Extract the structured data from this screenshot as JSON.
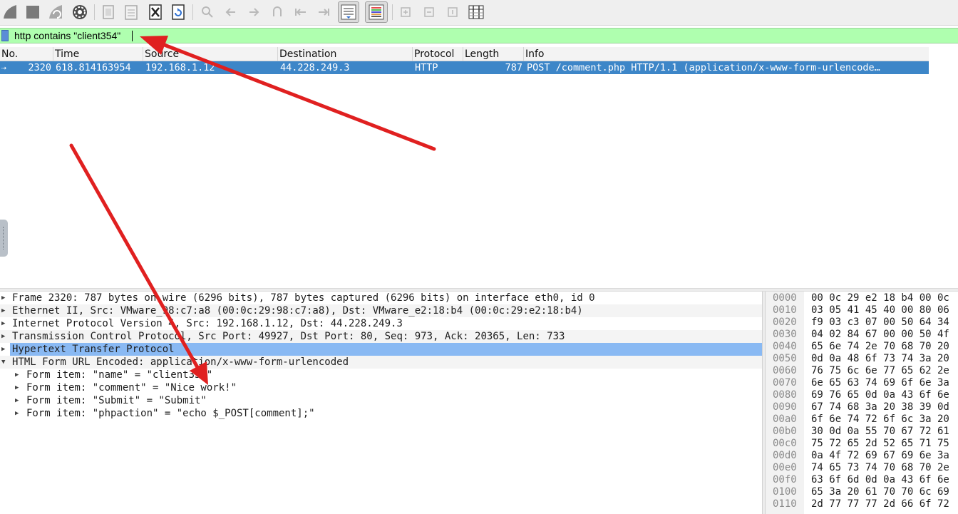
{
  "toolbar": {
    "buttons": [
      {
        "name": "start-capture-icon"
      },
      {
        "name": "stop-capture-icon"
      },
      {
        "name": "restart-capture-icon"
      },
      {
        "name": "capture-options-icon"
      },
      {
        "name": "open-file-icon"
      },
      {
        "name": "save-file-icon"
      },
      {
        "name": "close-file-icon"
      },
      {
        "name": "reload-file-icon"
      },
      {
        "name": "find-packet-icon"
      },
      {
        "name": "go-back-icon"
      },
      {
        "name": "go-forward-icon"
      },
      {
        "name": "go-to-packet-icon"
      },
      {
        "name": "go-first-icon"
      },
      {
        "name": "go-last-icon"
      },
      {
        "name": "auto-scroll-icon"
      },
      {
        "name": "colorize-icon"
      },
      {
        "name": "zoom-in-icon"
      },
      {
        "name": "zoom-out-icon"
      },
      {
        "name": "normal-size-icon"
      },
      {
        "name": "resize-columns-icon"
      }
    ]
  },
  "filter": {
    "value": "http contains \"client354\""
  },
  "packet_list": {
    "columns": [
      "No.",
      "Time",
      "Source",
      "Destination",
      "Protocol",
      "Length",
      "Info"
    ],
    "rows": [
      {
        "no": "2320",
        "time": "618.814163954",
        "source": "192.168.1.12",
        "destination": "44.228.249.3",
        "protocol": "HTTP",
        "length": "787",
        "info": "POST /comment.php HTTP/1.1  (application/x-www-form-urlencode…"
      }
    ]
  },
  "details": {
    "rows": [
      {
        "text": "Frame 2320: 787 bytes on wire (6296 bits), 787 bytes captured (6296 bits) on interface eth0, id 0",
        "expanded": false,
        "indent": 0
      },
      {
        "text": "Ethernet II, Src: VMware_98:c7:a8 (00:0c:29:98:c7:a8), Dst: VMware_e2:18:b4 (00:0c:29:e2:18:b4)",
        "expanded": false,
        "indent": 0
      },
      {
        "text": "Internet Protocol Version 4, Src: 192.168.1.12, Dst: 44.228.249.3",
        "expanded": false,
        "indent": 0
      },
      {
        "text": "Transmission Control Protocol, Src Port: 49927, Dst Port: 80, Seq: 973, Ack: 20365, Len: 733",
        "expanded": false,
        "indent": 0
      },
      {
        "text": "Hypertext Transfer Protocol",
        "expanded": false,
        "indent": 0,
        "selected": true
      },
      {
        "text": "HTML Form URL Encoded: application/x-www-form-urlencoded",
        "expanded": true,
        "indent": 0
      },
      {
        "text": "Form item: \"name\" = \"client354\"",
        "expanded": false,
        "indent": 1
      },
      {
        "text": "Form item: \"comment\" = \"Nice work!\"",
        "expanded": false,
        "indent": 1
      },
      {
        "text": "Form item: \"Submit\" = \"Submit\"",
        "expanded": false,
        "indent": 1
      },
      {
        "text": "Form item: \"phpaction\" = \"echo $_POST[comment];\"",
        "expanded": false,
        "indent": 1
      }
    ]
  },
  "bytes": {
    "rows": [
      {
        "offset": "0000",
        "hex": "00 0c 29 e2 18 b4 00 0c"
      },
      {
        "offset": "0010",
        "hex": "03 05 41 45 40 00 80 06"
      },
      {
        "offset": "0020",
        "hex": "f9 03 c3 07 00 50 64 34"
      },
      {
        "offset": "0030",
        "hex": "04 02 84 67 00 00 50 4f"
      },
      {
        "offset": "0040",
        "hex": "65 6e 74 2e 70 68 70 20"
      },
      {
        "offset": "0050",
        "hex": "0d 0a 48 6f 73 74 3a 20"
      },
      {
        "offset": "0060",
        "hex": "76 75 6c 6e 77 65 62 2e"
      },
      {
        "offset": "0070",
        "hex": "6e 65 63 74 69 6f 6e 3a"
      },
      {
        "offset": "0080",
        "hex": "69 76 65 0d 0a 43 6f 6e"
      },
      {
        "offset": "0090",
        "hex": "67 74 68 3a 20 38 39 0d"
      },
      {
        "offset": "00a0",
        "hex": "6f 6e 74 72 6f 6c 3a 20"
      },
      {
        "offset": "00b0",
        "hex": "30 0d 0a 55 70 67 72 61"
      },
      {
        "offset": "00c0",
        "hex": "75 72 65 2d 52 65 71 75"
      },
      {
        "offset": "00d0",
        "hex": "0a 4f 72 69 67 69 6e 3a"
      },
      {
        "offset": "00e0",
        "hex": "74 65 73 74 70 68 70 2e"
      },
      {
        "offset": "00f0",
        "hex": "63 6f 6d 0d 0a 43 6f 6e"
      },
      {
        "offset": "0100",
        "hex": "65 3a 20 61 70 70 6c 69"
      },
      {
        "offset": "0110",
        "hex": "2d 77 77 77 2d 66 6f 72"
      }
    ]
  },
  "colors": {
    "filter_valid": "#afffaf",
    "row_selected": "#3d86c8",
    "tree_selected": "#89b9f3",
    "annotation_arrow": "#e02020"
  }
}
